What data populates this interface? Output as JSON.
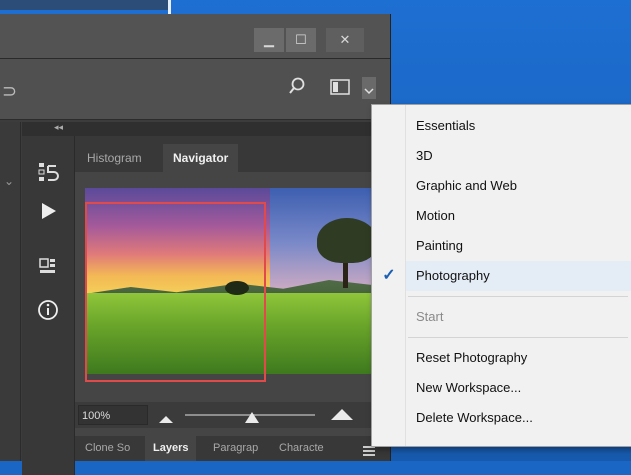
{
  "window": {
    "minimize_label": "▁",
    "maximize_label": "☐",
    "close_label": "✕"
  },
  "panel": {
    "tabs": [
      {
        "label": "Histogram"
      },
      {
        "label": "Navigator"
      }
    ],
    "zoom_value": "100%",
    "bottom_tabs": [
      {
        "label": "Clone So"
      },
      {
        "label": "Layers"
      },
      {
        "label": "Paragrap"
      },
      {
        "label": "Characte"
      }
    ]
  },
  "workspace_menu": {
    "items": [
      {
        "label": "Essentials"
      },
      {
        "label": "3D"
      },
      {
        "label": "Graphic and Web"
      },
      {
        "label": "Motion"
      },
      {
        "label": "Painting"
      },
      {
        "label": "Photography"
      },
      {
        "label": "Start"
      },
      {
        "label": "Reset Photography"
      },
      {
        "label": "New Workspace..."
      },
      {
        "label": "Delete Workspace..."
      }
    ],
    "checked_item": "Photography",
    "check_glyph": "✓"
  },
  "icons": {
    "search": "search-icon",
    "workspace": "workspace-icon",
    "panel_menu": "panel-menu-icon"
  }
}
